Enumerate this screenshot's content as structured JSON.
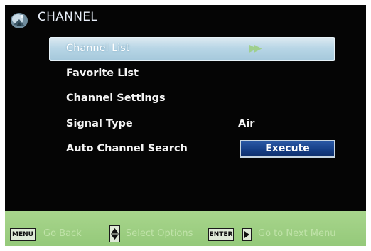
{
  "header": {
    "title": "CHANNEL",
    "icon": "satellite-dish-icon"
  },
  "menu": {
    "items": [
      {
        "label": "Channel List",
        "selected": true,
        "indicator": "▶▶"
      },
      {
        "label": "Favorite List"
      },
      {
        "label": "Channel Settings"
      },
      {
        "label": "Signal Type",
        "value": "Air"
      },
      {
        "label": "Auto Channel Search",
        "button": "Execute"
      }
    ]
  },
  "footer": {
    "menu_key": "MENU",
    "go_back": "Go Back",
    "select_options": "Select Options",
    "enter_key": "ENTER",
    "go_next": "Go to Next Menu"
  },
  "colors": {
    "background": "#050505",
    "highlight": "#b8d6e6",
    "footer": "#9ecf83",
    "button": "#163f87"
  }
}
